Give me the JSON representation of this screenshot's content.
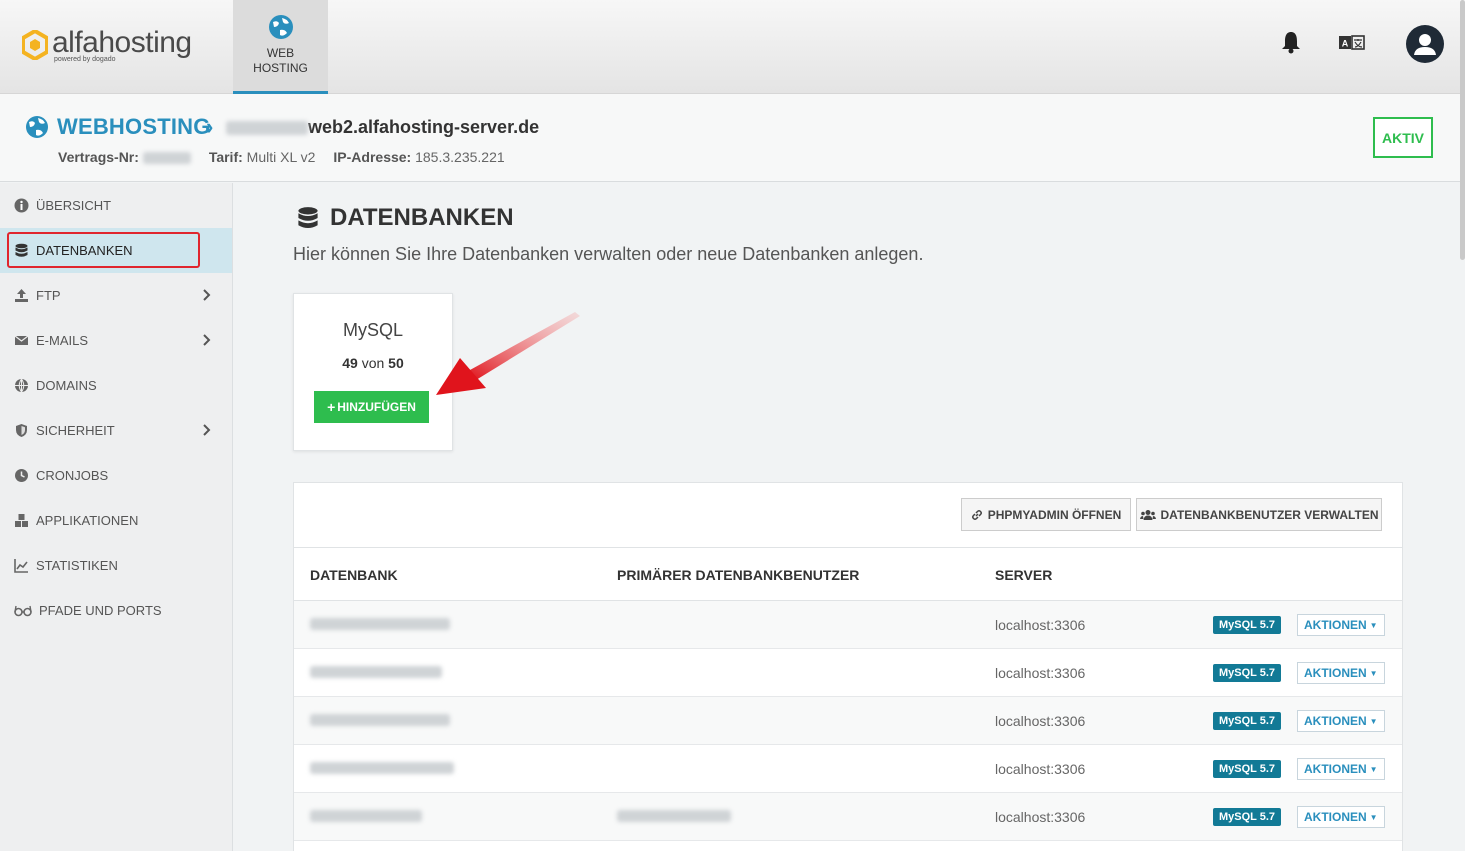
{
  "brand": {
    "name": "alfahosting",
    "tagline": "powered by dogado",
    "accent": "#2a8fbd",
    "green": "#2ebd4e"
  },
  "topnav": {
    "web_label_1": "WEB",
    "web_label_2": "HOSTING"
  },
  "header": {
    "title": "WEBHOSTING",
    "host_suffix": "web2.alfahosting-server.de",
    "contract_label": "Vertrags-Nr:",
    "tariff_label": "Tarif:",
    "tariff_value": "Multi XL v2",
    "ip_label": "IP-Adresse:",
    "ip_value": "185.3.235.221",
    "status": "AKTIV"
  },
  "sidebar": {
    "items": [
      {
        "label": "ÜBERSICHT",
        "icon": "info-icon"
      },
      {
        "label": "DATENBANKEN",
        "icon": "database-icon"
      },
      {
        "label": "FTP",
        "icon": "upload-icon"
      },
      {
        "label": "E-MAILS",
        "icon": "envelope-icon"
      },
      {
        "label": "DOMAINS",
        "icon": "globe-icon"
      },
      {
        "label": "SICHERHEIT",
        "icon": "shield-icon"
      },
      {
        "label": "CRONJOBS",
        "icon": "clock-icon"
      },
      {
        "label": "APPLIKATIONEN",
        "icon": "cubes-icon"
      },
      {
        "label": "STATISTIKEN",
        "icon": "chart-icon"
      },
      {
        "label": "PFADE UND PORTS",
        "icon": "glasses-icon"
      }
    ]
  },
  "main": {
    "title": "DATENBANKEN",
    "description": "Hier können Sie Ihre Datenbanken verwalten oder neue Datenbanken anlegen.",
    "card": {
      "title": "MySQL",
      "used": "49",
      "sep": "von",
      "total": "50",
      "add_label": "HINZUFÜGEN"
    },
    "buttons": {
      "phpmyadmin": "PHPMYADMIN ÖFFNEN",
      "users": "DATENBANKBENUTZER VERWALTEN"
    },
    "table": {
      "headers": [
        "DATENBANK",
        "PRIMÄRER DATENBANKBENUTZER",
        "SERVER"
      ],
      "rows": [
        {
          "server": "localhost:3306",
          "badge": "MySQL 5.7",
          "action": "AKTIONEN"
        },
        {
          "server": "localhost:3306",
          "badge": "MySQL 5.7",
          "action": "AKTIONEN"
        },
        {
          "server": "localhost:3306",
          "badge": "MySQL 5.7",
          "action": "AKTIONEN"
        },
        {
          "server": "localhost:3306",
          "badge": "MySQL 5.7",
          "action": "AKTIONEN"
        },
        {
          "server": "localhost:3306",
          "badge": "MySQL 5.7",
          "action": "AKTIONEN"
        }
      ]
    }
  }
}
